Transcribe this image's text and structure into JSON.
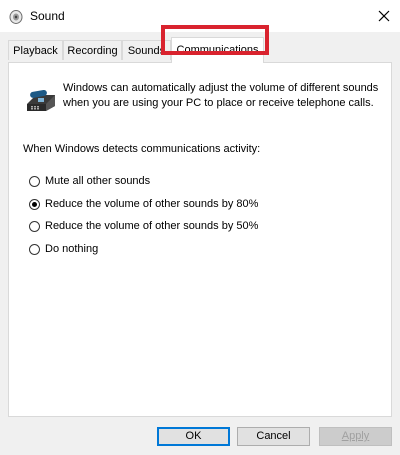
{
  "window": {
    "title": "Sound",
    "icon": "speaker-icon",
    "close_icon": "close-icon"
  },
  "tabs": [
    {
      "label": "Playback",
      "selected": false
    },
    {
      "label": "Recording",
      "selected": false
    },
    {
      "label": "Sounds",
      "selected": false
    },
    {
      "label": "Communications",
      "selected": true
    }
  ],
  "highlight_color": "#d9232e",
  "communications": {
    "icon": "phone-icon",
    "description": "Windows can automatically adjust the volume of different sounds when you are using your PC to place or receive telephone calls.",
    "detect_label": "When Windows detects communications activity:",
    "options": [
      {
        "label": "Mute all other sounds",
        "checked": false
      },
      {
        "label": "Reduce the volume of other sounds by 80%",
        "checked": true
      },
      {
        "label": "Reduce the volume of other sounds by 50%",
        "checked": false
      },
      {
        "label": "Do nothing",
        "checked": false
      }
    ]
  },
  "buttons": {
    "ok": "OK",
    "cancel": "Cancel",
    "apply": "Apply"
  },
  "colors": {
    "accent": "#0078d7",
    "panel_bg": "#ffffff",
    "window_bg": "#f0f0f0"
  }
}
